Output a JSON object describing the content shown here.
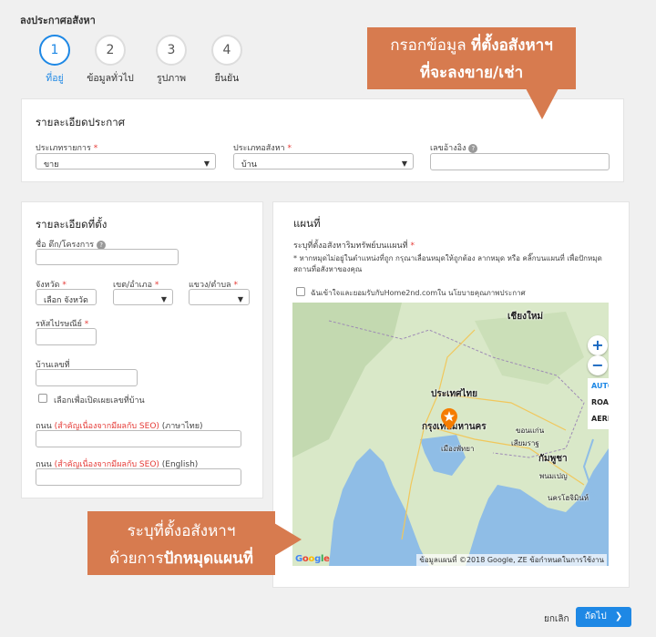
{
  "page": {
    "title": "ลงประกาศอสังหา"
  },
  "steps": [
    {
      "number": "1",
      "label": "ที่อยู่"
    },
    {
      "number": "2",
      "label": "ข้อมูลทั่วไป"
    },
    {
      "number": "3",
      "label": "รูปภาพ"
    },
    {
      "number": "4",
      "label": "ยืนยัน"
    }
  ],
  "callouts": {
    "top_line1_normal": "กรอกข้อมูล ",
    "top_line1_bold": "ที่ตั้งอสังหาฯ",
    "top_line2": "ที่จะลงขาย/เช่า",
    "bottom_line1": "ระบุที่ตั้งอสังหาฯ",
    "bottom_line2_normal": "ด้วยการ",
    "bottom_line2_bold": "ปักหมุดแผนที่"
  },
  "listing_details": {
    "title": "รายละเอียดประกาศ",
    "listing_type_label": "ประเภทรายการ",
    "listing_type_value": "ขาย",
    "property_type_label": "ประเภทอสังหา",
    "property_type_value": "บ้าน",
    "reference_label": "เลขอ้างอิง",
    "reference_value": ""
  },
  "location": {
    "title": "รายละเอียดที่ตั้ง",
    "project_label": "ชื่อ ตึก/โครงการ",
    "province_label": "จังหวัด",
    "province_value": "เลือก จังหวัด",
    "district_label": "เขต/อำเภอ",
    "district_value": "",
    "subdistrict_label": "แขวง/ตำบล",
    "subdistrict_value": "",
    "postcode_label": "รหัสไปรษณีย์",
    "house_no_label": "บ้านเลขที่",
    "show_house_no_label": "เลือกเพื่อเปิดเผยเลขที่บ้าน",
    "road_th_prefix": "ถนน ",
    "road_th_hint": "(สำคัญเนื่องจากมีผลกับ SEO)",
    "road_th_suffix": " (ภาษาไทย)",
    "road_en_prefix": "ถนน ",
    "road_en_hint": "(สำคัญเนื่องจากมีผลกับ SEO)",
    "road_en_suffix": " (English)",
    "required_mark": "*"
  },
  "map_section": {
    "title": "แผนที่",
    "instruction": "ระบุที่ตั้งอสังหาริมทรัพย์บนแผนที่",
    "note_line1": "* หากหมุดไม่อยู่ในตำแหน่งที่ถูก กรุณาเลื่อนหมุดให้ถูกต้อง ลากหมุด หรือ คลิ๊กบนแผนที่ เพื่อปักหมุด",
    "note_line2": "สถานที่อสังหาของคุณ",
    "consent_label": "ฉันเข้าใจและยอมรับกับHome2nd.comใน นโยบายคุณภาพประกาศ",
    "map_labels": {
      "chiang_mai": "เชียงใหม่",
      "thailand": "ประเทศไทย",
      "bangkok": "กรุงเทพมหานคร",
      "cambodia": "กัมพูชา",
      "phnom_penh": "พนมเปญ",
      "ho_chi_minh": "นครโฮจิมินห์",
      "khon_kaen": "ขอนแก่น",
      "pattaya": "เมืองพัทยา",
      "siem_reap": "เสียมราฐ"
    },
    "zoom_in": "+",
    "zoom_out": "−",
    "map_types": [
      "AUTO",
      "ROAD",
      "AERIAL"
    ],
    "google_logo": "Google",
    "attribution": "ข้อมูลแผนที่ ©2018 Google, ZE ข้อกำหนดในการใช้งาน"
  },
  "footer": {
    "cancel_label": "ยกเลิก",
    "next_label": "ถัดไป"
  },
  "colors": {
    "accent": "#1e88e5",
    "callout": "#d77b4f",
    "required": "#e53935",
    "sea": "#8fbde6",
    "land": "#d9e8c8",
    "marker": "#f57c00"
  }
}
